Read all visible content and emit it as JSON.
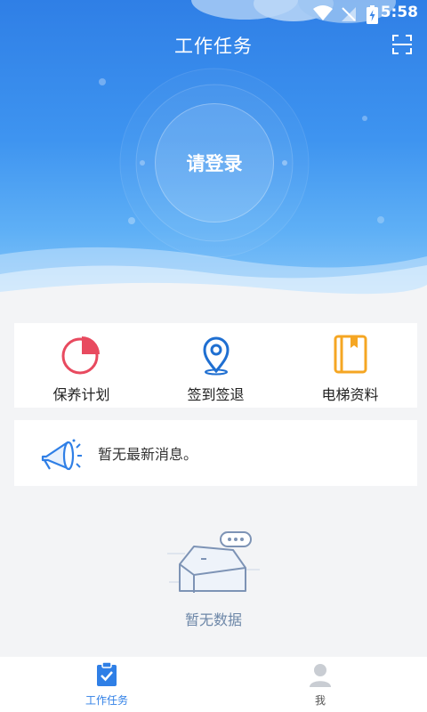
{
  "status_bar": {
    "time": "5:58",
    "icons": [
      "wifi-icon",
      "no-signal-icon",
      "battery-charging-icon"
    ]
  },
  "header": {
    "title": "工作任务",
    "scan_icon": "scan-icon"
  },
  "hero": {
    "login_label": "请登录"
  },
  "colors": {
    "primary": "#2f7fe6",
    "red_accent": "#e84a5f",
    "orange_accent": "#f5a623",
    "muted_blue": "#6d87a8"
  },
  "features": [
    {
      "label": "保养计划",
      "icon": "pie-chart-icon"
    },
    {
      "label": "签到签退",
      "icon": "location-pin-icon"
    },
    {
      "label": "电梯资料",
      "icon": "book-icon"
    }
  ],
  "notice": {
    "text": "暂无最新消息。",
    "icon": "megaphone-icon"
  },
  "empty_state": {
    "text": "暂无数据",
    "icon": "empty-box-icon"
  },
  "tabbar": [
    {
      "label": "工作任务",
      "icon": "clipboard-check-icon",
      "active": true
    },
    {
      "label": "我",
      "icon": "user-icon",
      "active": false
    }
  ]
}
